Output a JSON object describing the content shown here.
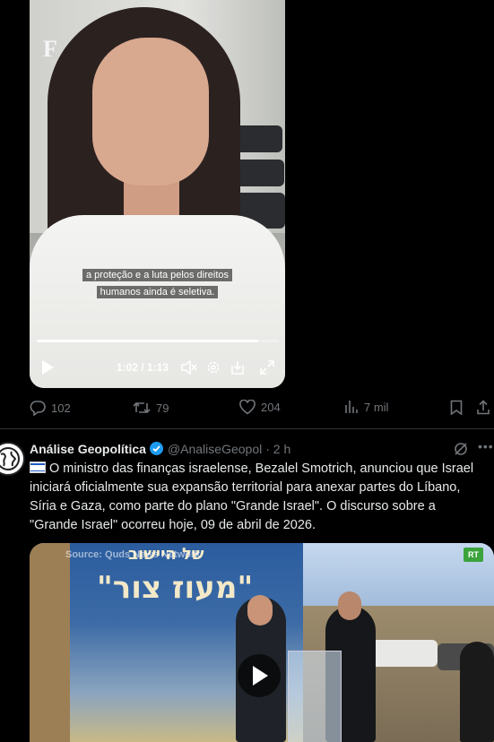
{
  "video1": {
    "brand_logo": "F",
    "caption_line1": "a proteção e a luta pelos direitos",
    "caption_line2": "humanos ainda é seletiva.",
    "time": "1:02 / 1:13",
    "progress": 0.915
  },
  "actions": {
    "replies": "102",
    "reposts": "79",
    "likes": "204",
    "views": "7 mil"
  },
  "tweet2": {
    "display_name": "Análise Geopolítica",
    "handle": "@AnaliseGeopol",
    "time": "· 2 h",
    "text": "O ministro das finanças israelense, Bezalel Smotrich, anunciou que Israel iniciará oficialmente sua expansão territorial para anexar partes do Líbano, Síria e Gaza, como parte do plano \"Grande Israel\". O discurso sobre a \"Grande Israel\" ocorreu hoje, 09 de abril de 2026.",
    "flag_icon": "israel-flag-icon"
  },
  "video2": {
    "source_watermark": "Source: Quds News Network",
    "channel_badge": "RT",
    "banner_line1": "של היישוב",
    "banner_line2": "\"מעוז צור\""
  },
  "colors": {
    "background": "#000000",
    "text": "#e7e9ea",
    "muted": "#71767b",
    "verified": "#1d9bf0"
  }
}
